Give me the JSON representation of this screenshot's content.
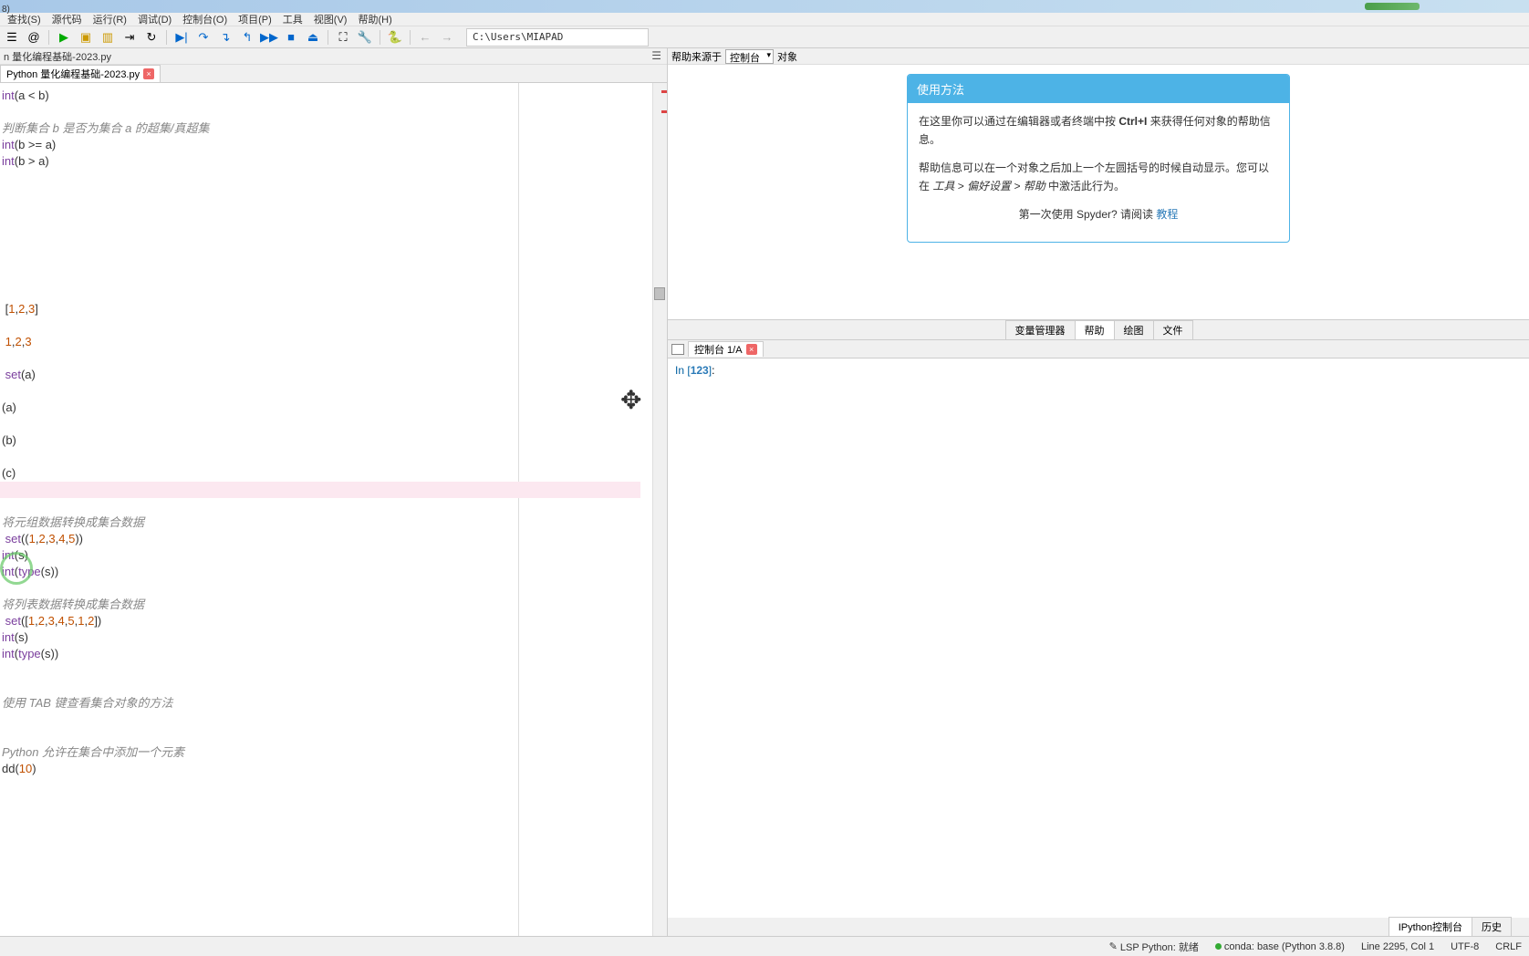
{
  "titlebar_frag": "8)",
  "menus": [
    "查找(S)",
    "源代码",
    "运行(R)",
    "调试(D)",
    "控制台(O)",
    "项目(P)",
    "工具",
    "视图(V)",
    "帮助(H)"
  ],
  "path": "C:\\Users\\MIAPAD",
  "breadcrumb": "n 量化编程基础-2023.py",
  "file_tab": "Python 量化编程基础-2023.py",
  "code_lines": [
    {
      "t": "int(a < b)",
      "cls": ""
    },
    {
      "t": "",
      "cls": ""
    },
    {
      "t": "判断集合 b 是否为集合 a 的超集/真超集",
      "cls": "cm"
    },
    {
      "t": "int(b >= a)",
      "cls": ""
    },
    {
      "t": "int(b > a)",
      "cls": ""
    },
    {
      "t": "",
      "cls": ""
    },
    {
      "t": "",
      "cls": ""
    },
    {
      "t": "",
      "cls": ""
    },
    {
      "t": "",
      "cls": ""
    },
    {
      "t": "",
      "cls": ""
    },
    {
      "t": "",
      "cls": ""
    },
    {
      "t": "",
      "cls": ""
    },
    {
      "t": "",
      "cls": ""
    },
    {
      "t": " [1,2,3]",
      "cls": ""
    },
    {
      "t": "",
      "cls": ""
    },
    {
      "t": " 1,2,3",
      "cls": ""
    },
    {
      "t": "",
      "cls": ""
    },
    {
      "t": " set(a)",
      "cls": ""
    },
    {
      "t": "",
      "cls": ""
    },
    {
      "t": "(a)",
      "cls": ""
    },
    {
      "t": "",
      "cls": ""
    },
    {
      "t": "(b)",
      "cls": ""
    },
    {
      "t": "",
      "cls": ""
    },
    {
      "t": "(c)",
      "cls": ""
    },
    {
      "t": "",
      "cls": "",
      "hl": true
    },
    {
      "t": "",
      "cls": ""
    },
    {
      "t": "将元组数据转换成集合数据",
      "cls": "cm"
    },
    {
      "t": " set((1,2,3,4,5))",
      "cls": ""
    },
    {
      "t": "int(s)",
      "cls": ""
    },
    {
      "t": "int(type(s))",
      "cls": ""
    },
    {
      "t": "",
      "cls": ""
    },
    {
      "t": "将列表数据转换成集合数据",
      "cls": "cm"
    },
    {
      "t": " set([1,2,3,4,5,1,2])",
      "cls": ""
    },
    {
      "t": "int(s)",
      "cls": ""
    },
    {
      "t": "int(type(s))",
      "cls": ""
    },
    {
      "t": "",
      "cls": ""
    },
    {
      "t": "",
      "cls": ""
    },
    {
      "t": "使用 TAB 键查看集合对象的方法",
      "cls": "cm"
    },
    {
      "t": "",
      "cls": ""
    },
    {
      "t": "",
      "cls": ""
    },
    {
      "t": "Python 允许在集合中添加一个元素",
      "cls": "cm"
    },
    {
      "t": "dd(10)",
      "cls": ""
    }
  ],
  "help": {
    "source_label": "帮助来源于",
    "source_value": "控制台",
    "object_label": "对象",
    "title": "使用方法",
    "p1_a": "在这里你可以通过在编辑器或者终端中按 ",
    "p1_kbd": "Ctrl+I",
    "p1_b": " 来获得任何对象的帮助信息。",
    "p2_a": "帮助信息可以在一个对象之后加上一个左圆括号的时候自动显示。您可以在 ",
    "p2_i": "工具 > 偏好设置 > 帮助",
    "p2_b": " 中激活此行为。",
    "p3_a": "第一次使用 Spyder? 请阅读 ",
    "p3_link": "教程"
  },
  "help_tabs": [
    "变量管理器",
    "帮助",
    "绘图",
    "文件"
  ],
  "help_active_tab": "帮助",
  "console_tab": "控制台 1/A",
  "console_prompt": "In ",
  "console_num": "123",
  "console_tail": ":",
  "console_btabs": [
    "IPython控制台",
    "历史"
  ],
  "status": {
    "lsp": "LSP Python: 就绪",
    "conda": "conda: base (Python 3.8.8)",
    "line": "Line 2295, Col 1",
    "enc": "UTF-8",
    "eol": "CRLF"
  }
}
